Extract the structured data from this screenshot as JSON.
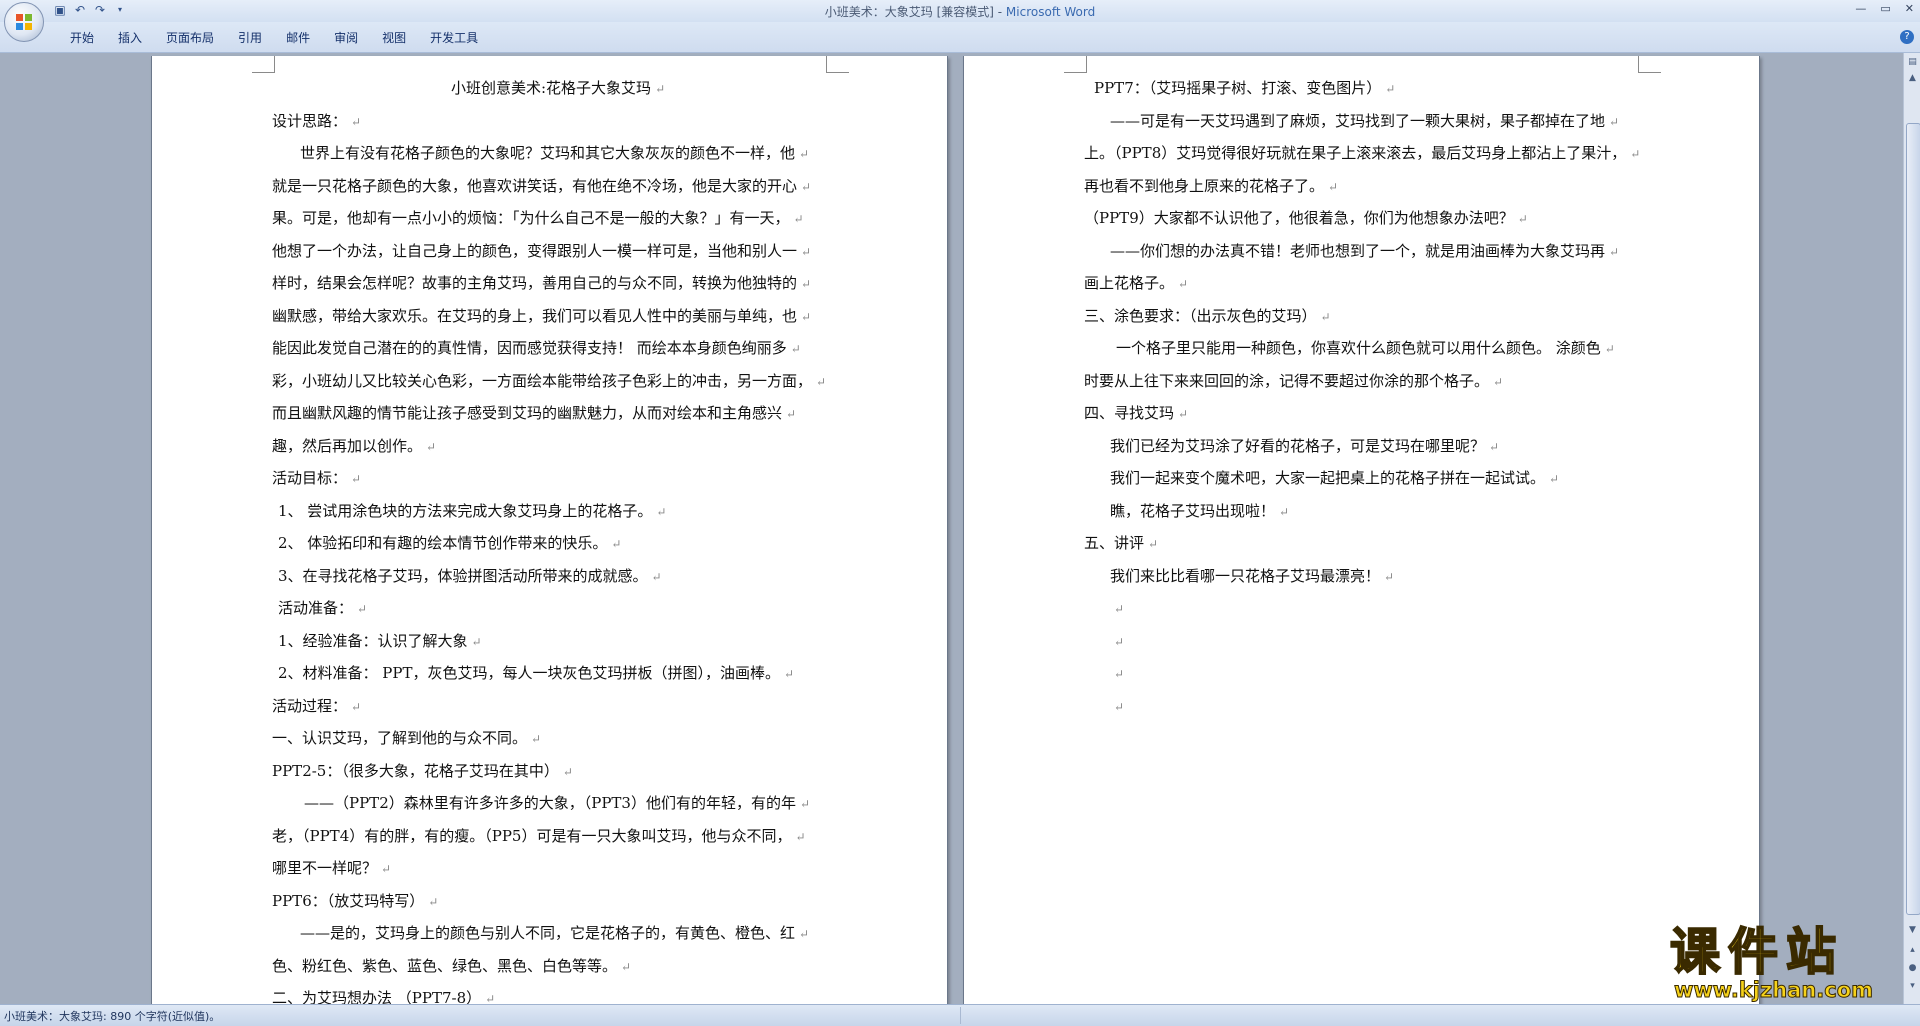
{
  "window": {
    "title": "小班美术：大象艾玛 [兼容模式] - ",
    "app_name": "Microsoft Word",
    "controls": [
      "—",
      "▭",
      "✕"
    ]
  },
  "quick_access": {
    "save_icon": "save-icon",
    "undo_icon": "undo-icon",
    "redo_icon": "redo-icon",
    "customize_icon": "customize-arrow-icon"
  },
  "ribbon": {
    "tabs": [
      "开始",
      "插入",
      "页面布局",
      "引用",
      "邮件",
      "审阅",
      "视图",
      "开发工具"
    ],
    "help": "?"
  },
  "document": {
    "left_page": [
      "小班创意美术:花格子大象艾玛",
      "设计思路：",
      "世界上有没有花格子颜色的大象呢？艾玛和其它大象灰灰的颜色不一样，他",
      "就是一只花格子颜色的大象，他喜欢讲笑话，有他在绝不冷场，他是大家的开心",
      "果。可是，他却有一点小小的烦恼：「为什么自己不是一般的大象？」有一天，",
      "他想了一个办法，让自己身上的颜色，变得跟别人一模一样可是，当他和别人一",
      "样时，结果会怎样呢？故事的主角艾玛，善用自己的与众不同，转换为他独特的",
      "幽默感，带给大家欢乐。在艾玛的身上，我们可以看见人性中的美丽与单纯，也",
      "能因此发觉自己潜在的的真性情，因而感觉获得支持！  而绘本本身颜色绚丽多",
      "彩，小班幼儿又比较关心色彩，一方面绘本能带给孩子色彩上的冲击，另一方面，",
      "而且幽默风趣的情节能让孩子感受到艾玛的幽默魅力，从而对绘本和主角感兴",
      "趣，然后再加以创作。",
      "活动目标：",
      "1、 尝试用涂色块的方法来完成大象艾玛身上的花格子。",
      "2、 体验拓印和有趣的绘本情节创作带来的快乐。",
      "3、在寻找花格子艾玛，体验拼图活动所带来的成就感。",
      "活动准备：",
      "1、经验准备：认识了解大象",
      "2、材料准备： PPT，灰色艾玛，每人一块灰色艾玛拼板（拼图），油画棒。",
      "活动过程：",
      "一、认识艾玛，了解到他的与众不同。",
      "PPT2-5：（很多大象，花格子艾玛在其中）",
      "——（PPT2）森林里有许多许多的大象，（PPT3）他们有的年轻，有的年",
      "老，（PPT4）有的胖，有的瘦。（PP5）可是有一只大象叫艾玛，他与众不同，",
      "哪里不一样呢？",
      "PPT6：（放艾玛特写）",
      "——是的，艾玛身上的颜色与别人不同，它是花格子的，有黄色、橙色、红",
      "色、粉红色、紫色、蓝色、绿色、黑色、白色等等。",
      "二、为艾玛想办法  （PPT7-8）"
    ],
    "right_page": [
      "PPT7：（艾玛摇果子树、打滚、变色图片）",
      "——可是有一天艾玛遇到了麻烦，艾玛找到了一颗大果树，果子都掉在了地",
      "上。（PPT8）艾玛觉得很好玩就在果子上滚来滚去，最后艾玛身上都沾上了果汁，",
      "再也看不到他身上原来的花格子了。",
      "（PPT9）大家都不认识他了，他很着急，你们为他想象办法吧？",
      "——你们想的办法真不错！老师也想到了一个，就是用油画棒为大象艾玛再",
      "画上花格子。",
      "三、涂色要求：（出示灰色的艾玛）",
      "一个格子里只能用一种颜色，你喜欢什么颜色就可以用什么颜色。 涂颜色",
      "时要从上往下来来回回的涂，记得不要超过你涂的那个格子。",
      "四、寻找艾玛",
      "我们已经为艾玛涂了好看的花格子，可是艾玛在哪里呢？",
      "我们一起来变个魔术吧，大家一起把桌上的花格子拼在一起试试。",
      "瞧，花格子艾玛出现啦！",
      "五、讲评",
      "我们来比比看哪一只花格子艾玛最漂亮！",
      "",
      "",
      "",
      ""
    ],
    "paragraph_mark": "↵"
  },
  "status": {
    "text": "小班美术：大象艾玛: 890 个字符(近似值)。"
  },
  "watermark": {
    "cn": "课件站",
    "url": "www.kjzhan.com"
  },
  "colors": {
    "app_name": "#3a6ab0",
    "watermark": "#f6d21a",
    "doc_background": "#a3aebf"
  }
}
